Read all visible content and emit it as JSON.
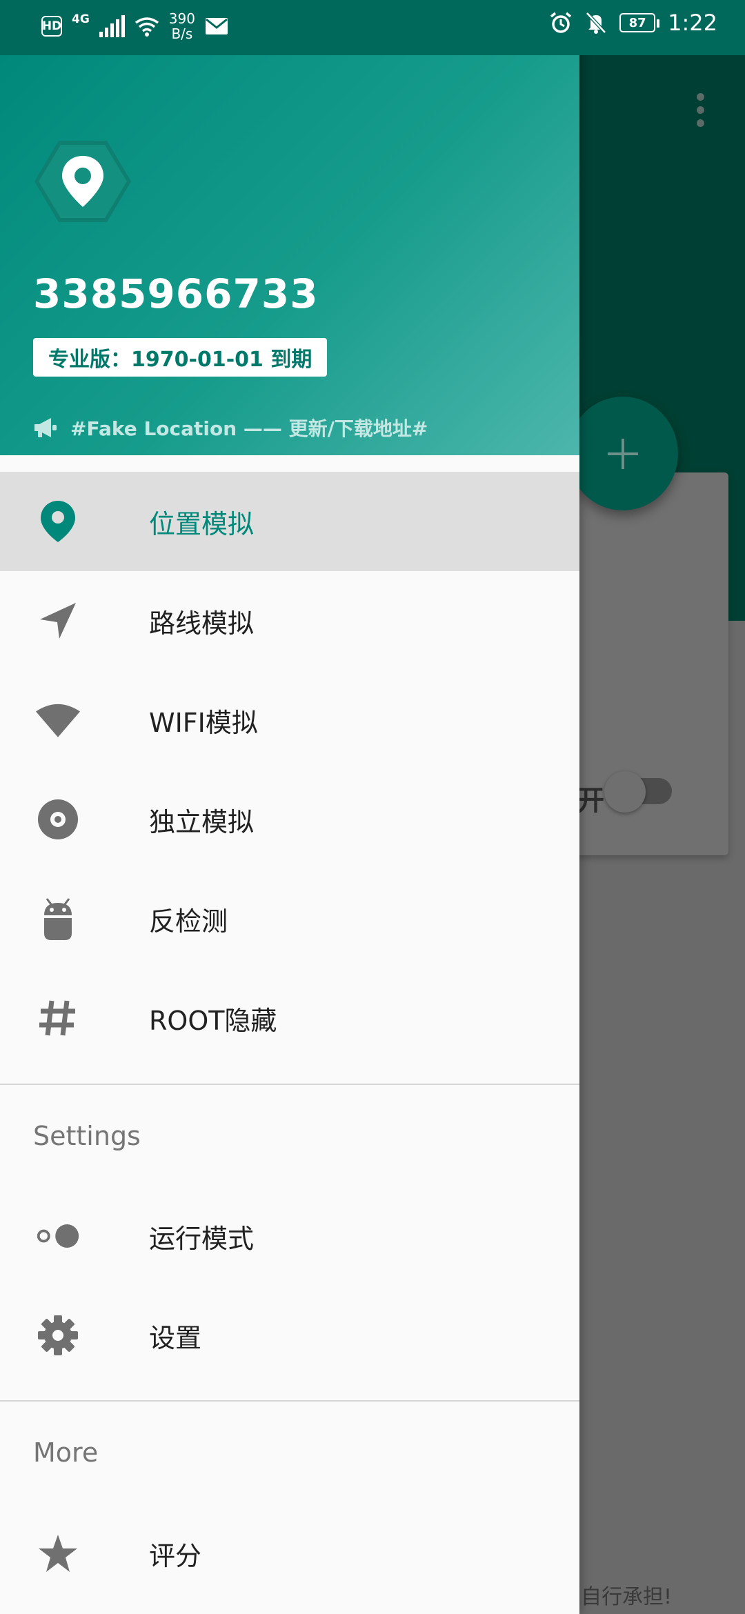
{
  "status_bar": {
    "hd": "HD",
    "network": "4G",
    "speed_value": "390",
    "speed_unit": "B/s",
    "battery": "87",
    "time": "1:22"
  },
  "drawer": {
    "user_id": "3385966733",
    "plan": "专业版：1970-01-01 到期",
    "notice": "#Fake Location —— 更新/下载地址#",
    "menu": [
      {
        "label": "位置模拟",
        "icon": "location-pin-icon",
        "active": true
      },
      {
        "label": "路线模拟",
        "icon": "navigation-arrow-icon"
      },
      {
        "label": "WIFI模拟",
        "icon": "wifi-icon"
      },
      {
        "label": "独立模拟",
        "icon": "disc-icon"
      },
      {
        "label": "反检测",
        "icon": "android-icon"
      },
      {
        "label": "ROOT隐藏",
        "icon": "hash-icon"
      }
    ],
    "settings_title": "Settings",
    "settings": [
      {
        "label": "运行模式",
        "icon": "run-mode-toggle-icon"
      },
      {
        "label": "设置",
        "icon": "gear-icon"
      }
    ],
    "more_title": "More",
    "more": [
      {
        "label": "评分",
        "icon": "star-icon"
      }
    ]
  },
  "background": {
    "card_text_fragment": "开",
    "footer_fragment": "自行承担!"
  },
  "colors": {
    "accent": "#00897b",
    "status_bar": "#00695c",
    "icon_grey": "#757575"
  }
}
